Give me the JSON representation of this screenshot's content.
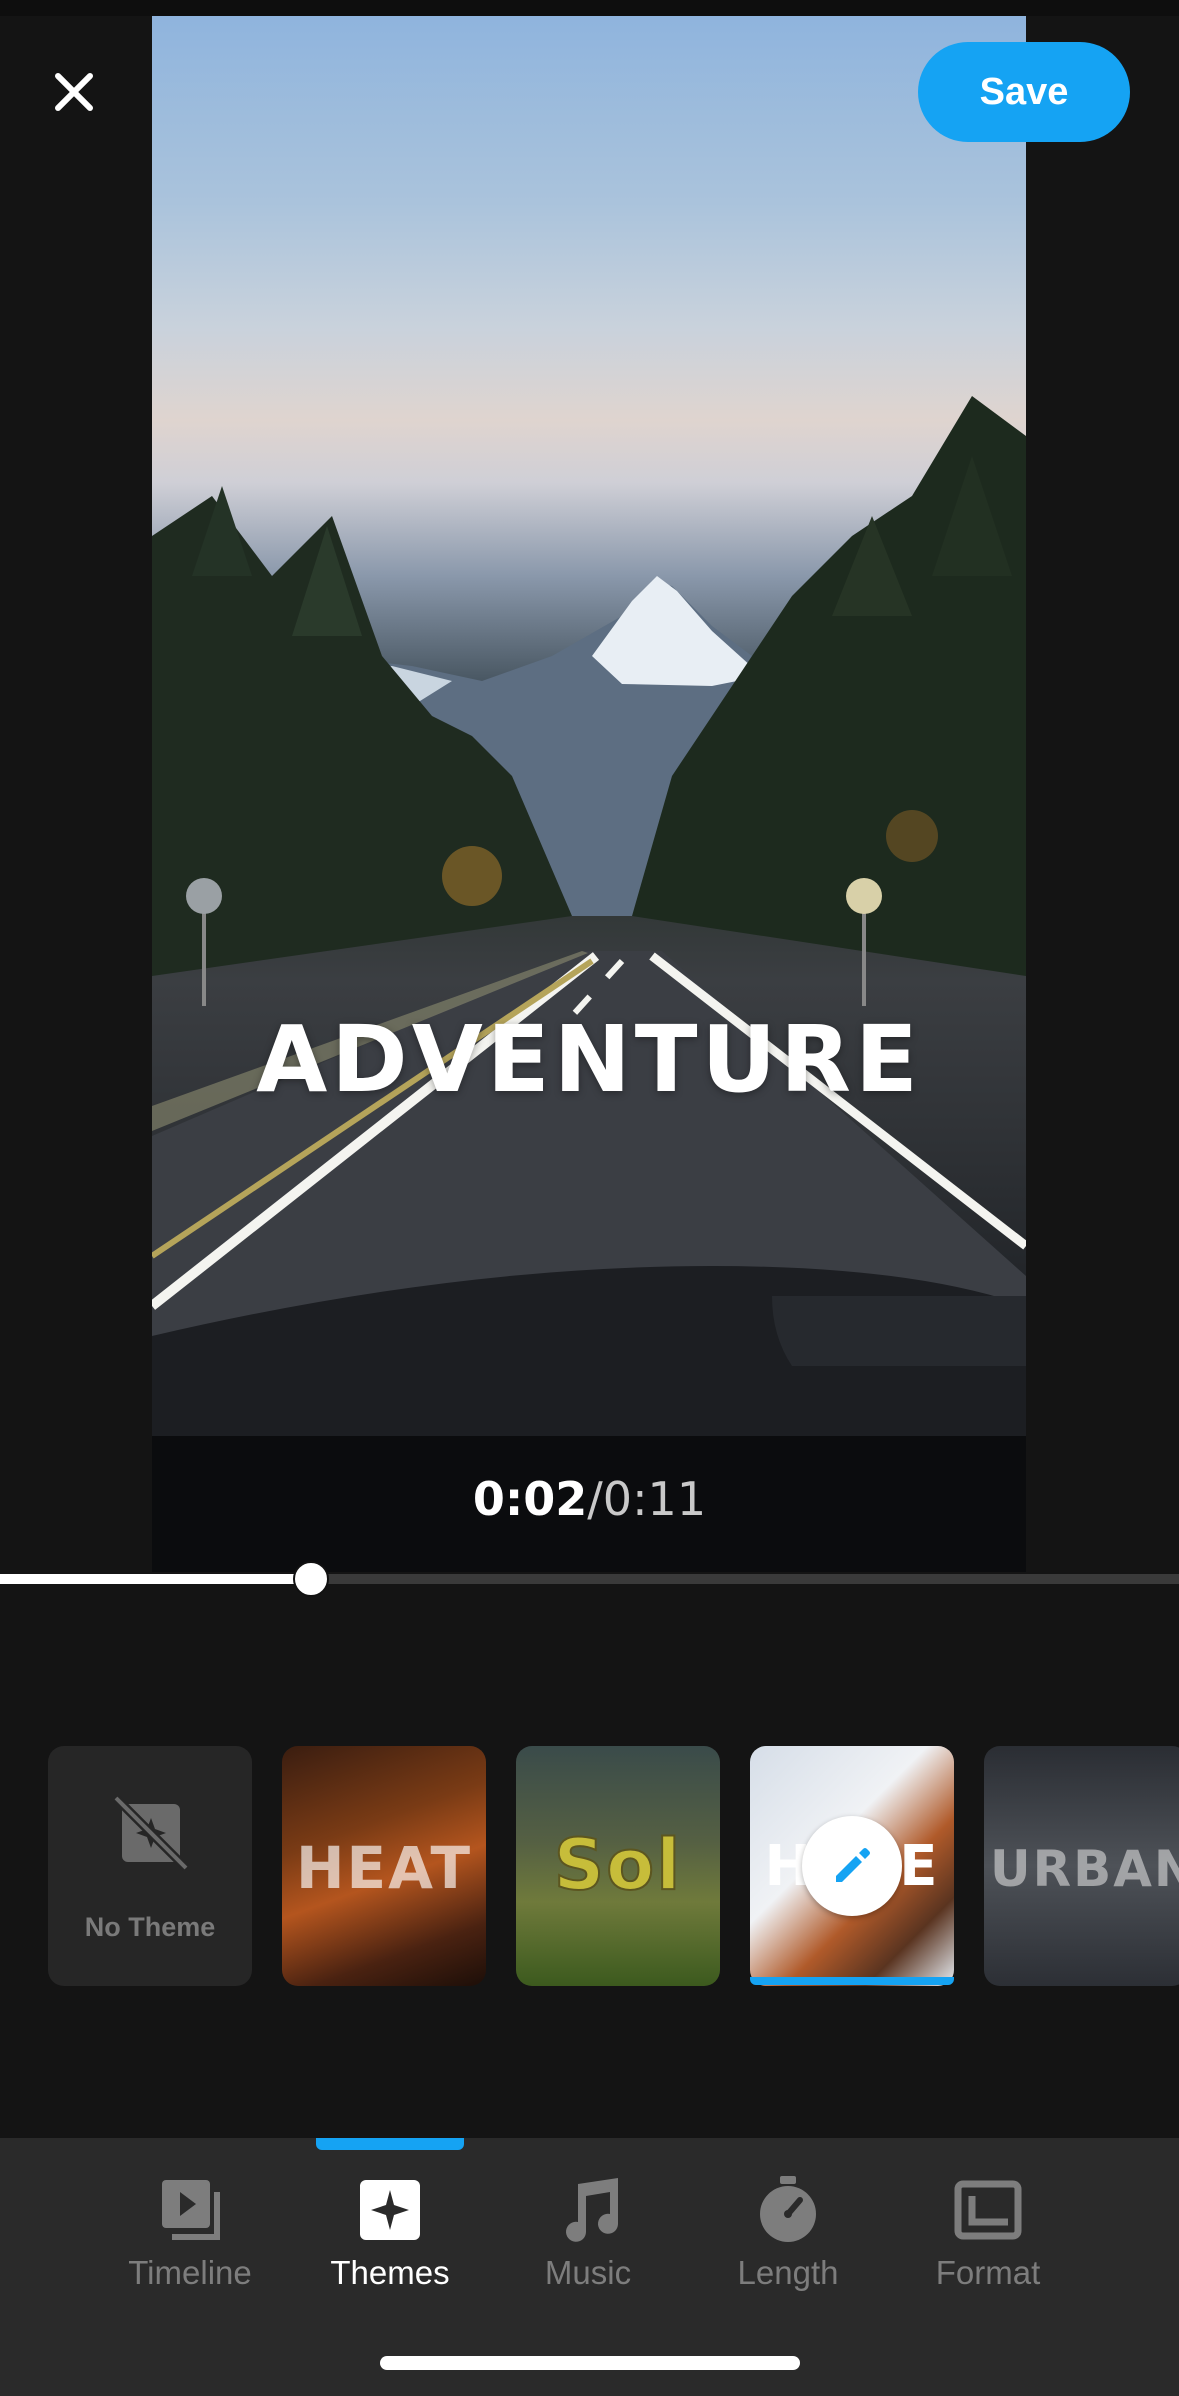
{
  "header": {
    "close_icon": "close-icon",
    "save_label": "Save"
  },
  "preview": {
    "title_overlay": "ADVENTURE",
    "current_time": "0:02",
    "separator": "/",
    "total_time": "0:11",
    "progress": 0.22
  },
  "themes": {
    "items": [
      {
        "label": "No Theme",
        "icon": "no-theme-icon"
      },
      {
        "label": "HEAT"
      },
      {
        "label": "Sol"
      },
      {
        "label": "H    E",
        "selected": true,
        "action_icon": "pencil-icon"
      },
      {
        "label": "URBAN"
      }
    ]
  },
  "tabs": [
    {
      "label": "Timeline",
      "icon": "timeline-icon"
    },
    {
      "label": "Themes",
      "icon": "themes-sparkle-icon",
      "active": true
    },
    {
      "label": "Music",
      "icon": "music-note-icon"
    },
    {
      "label": "Length",
      "icon": "stopwatch-icon"
    },
    {
      "label": "Format",
      "icon": "format-icon"
    }
  ],
  "colors": {
    "accent": "#15a3f3",
    "background": "#141414",
    "tabbar": "#2a2a2a"
  }
}
